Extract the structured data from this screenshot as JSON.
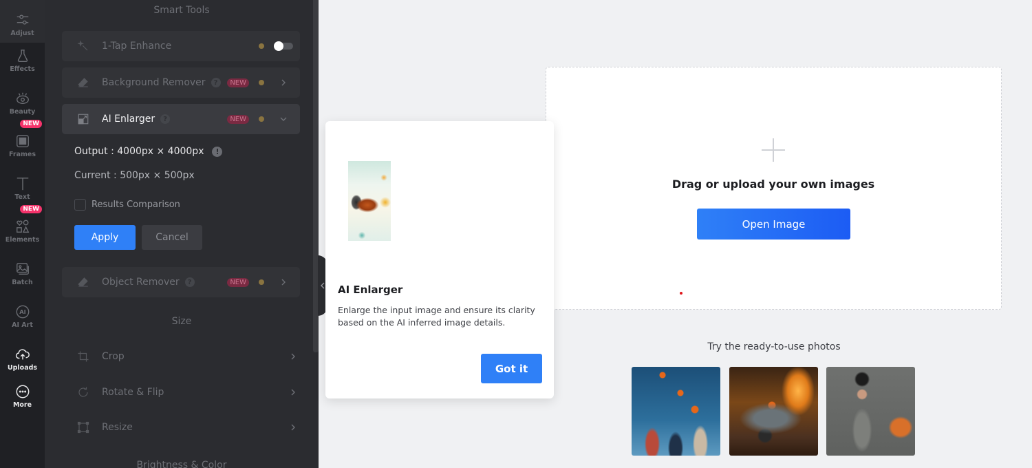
{
  "rail": {
    "items": [
      {
        "label": "Adjust",
        "icon": "sliders-icon",
        "active": true
      },
      {
        "label": "Effects",
        "icon": "flask-icon"
      },
      {
        "label": "Beauty",
        "icon": "eye-icon"
      },
      {
        "label": "Frames",
        "icon": "frame-icon",
        "badge": "NEW"
      },
      {
        "label": "Text",
        "icon": "text-icon"
      },
      {
        "label": "Elements",
        "icon": "shapes-icon",
        "badge": "NEW"
      },
      {
        "label": "Batch",
        "icon": "images-icon"
      },
      {
        "label": "AI Art",
        "icon": "ai-icon"
      },
      {
        "label": "Uploads",
        "icon": "cloud-upload-icon"
      },
      {
        "label": "More",
        "icon": "more-icon"
      }
    ]
  },
  "panel": {
    "smart_tools_title": "Smart Tools",
    "tools": [
      {
        "label": "1-Tap Enhance",
        "icon": "magic-wand-icon",
        "toggle": false
      },
      {
        "label": "Background Remover",
        "icon": "eraser-icon",
        "badge": "NEW"
      },
      {
        "label": "AI Enlarger",
        "icon": "enlarge-icon",
        "badge": "NEW",
        "expanded": true
      },
      {
        "label": "Object Remover",
        "icon": "eraser-icon",
        "badge": "NEW"
      }
    ],
    "enlarger": {
      "output": "Output : 4000px × 4000px",
      "current": "Current : 500px × 500px",
      "comparison_label": "Results Comparison",
      "comparison_checked": false,
      "apply": "Apply",
      "cancel": "Cancel"
    },
    "size_title": "Size",
    "size_tools": [
      {
        "label": "Crop",
        "icon": "crop-icon"
      },
      {
        "label": "Rotate & Flip",
        "icon": "rotate-icon"
      },
      {
        "label": "Resize",
        "icon": "resize-icon"
      }
    ],
    "brightness_title": "Brightness & Color"
  },
  "popover": {
    "title": "AI Enlarger",
    "description": "Enlarge the input image and ensure its clarity based on the AI inferred image details.",
    "button": "Got it"
  },
  "dropzone": {
    "title": "Drag or upload your own images",
    "button": "Open Image"
  },
  "samples": {
    "title": "Try the ready-to-use photos",
    "items": [
      "pumpkin-toss-photo",
      "halloween-truck-photo",
      "witch-girl-photo"
    ]
  },
  "colors": {
    "accent": "#2f80f7",
    "badge": "#f5336b",
    "panel_bg": "#2b2c30",
    "rail_bg": "#1f2024"
  }
}
